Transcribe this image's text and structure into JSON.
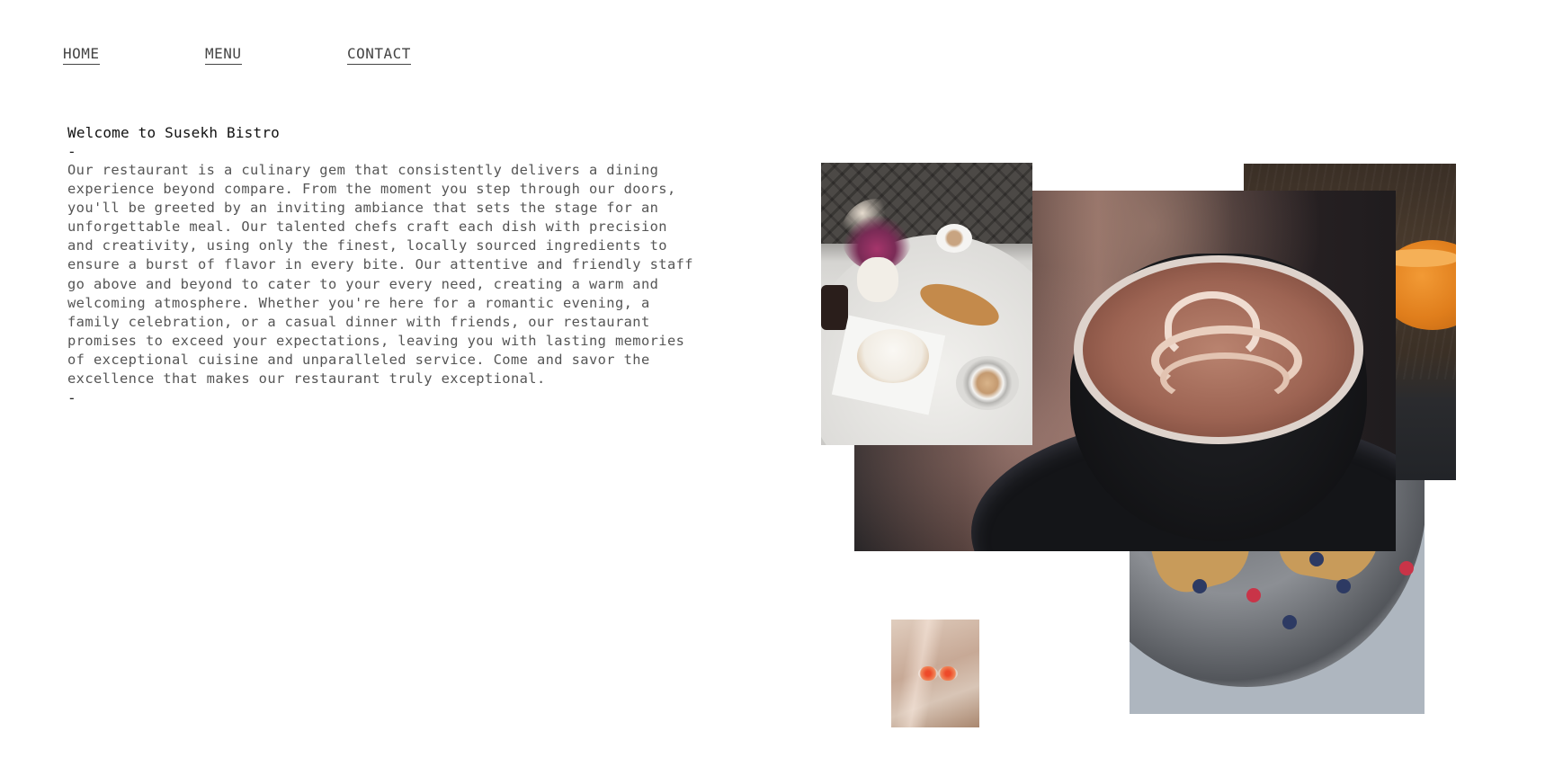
{
  "nav": {
    "home": "HOME",
    "menu": "MENU",
    "contact": "CONTACT"
  },
  "intro": {
    "title": "Welcome to Susekh Bistro",
    "dash_top": "-",
    "body": "Our restaurant is a culinary gem that consistently delivers a dining\nexperience beyond compare. From the moment you step through our doors,\nyou'll be greeted by an inviting ambiance that sets the stage for an\nunforgettable meal. Our talented chefs craft each dish with precision\nand creativity, using only the finest, locally sourced ingredients to\nensure a burst of flavor in every bite. Our attentive and friendly staff\ngo above and beyond to cater to your every need, creating a warm and\nwelcoming atmosphere. Whether you're here for a romantic evening, a\nfamily celebration, or a casual dinner with friends, our restaurant\npromises to exceed your expectations, leaving you with lasting memories\nof exceptional cuisine and unparalleled service. Come and savor the\nexcellence that makes our restaurant truly exceptional.",
    "dash_bottom": "-"
  },
  "colors": {
    "background": "#ffffff",
    "text": "#555555",
    "heading": "#111111"
  }
}
